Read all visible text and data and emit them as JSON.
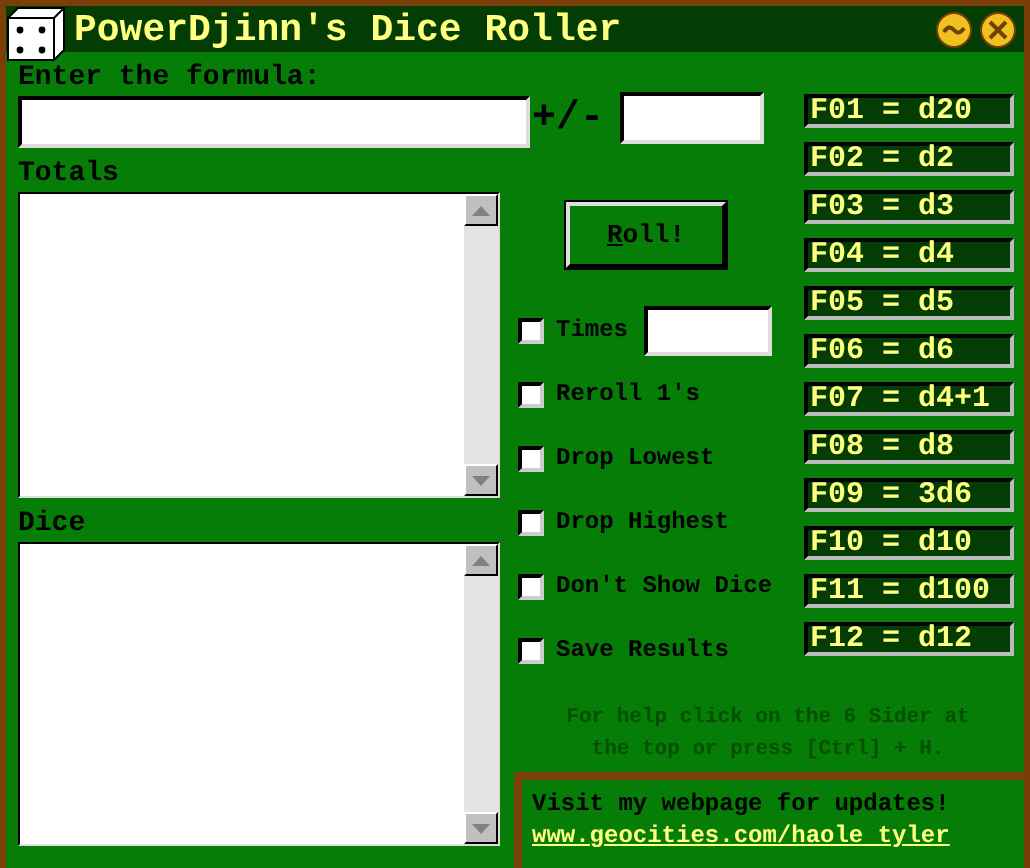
{
  "window": {
    "title": "PowerDjinn's Dice Roller"
  },
  "formula": {
    "label": "Enter the formula:",
    "modifier_label": "+/-"
  },
  "totals": {
    "label": "Totals"
  },
  "dice": {
    "label": "Dice"
  },
  "roll_button": {
    "underlined_part": "R",
    "rest": "oll!"
  },
  "options": [
    {
      "kind": "times",
      "label": "Times",
      "checked": false
    },
    {
      "kind": "plain",
      "label": "Reroll 1's",
      "checked": false
    },
    {
      "kind": "plain",
      "label": "Drop Lowest",
      "checked": false
    },
    {
      "kind": "plain",
      "label": "Drop Highest",
      "checked": false
    },
    {
      "kind": "plain",
      "label": "Don't Show Dice",
      "checked": false
    },
    {
      "kind": "plain",
      "label": "Save Results",
      "checked": false
    }
  ],
  "function_keys": [
    "F01 = d20",
    "F02 = d2",
    "F03 = d3",
    "F04 = d4",
    "F05 = d5",
    "F06 = d6",
    "F07 = d4+1",
    "F08 = d8",
    "F09 = 3d6",
    "F10 = d10",
    "F11 = d100",
    "F12 = d12"
  ],
  "help_text": "For help click on the 6 Sider at the top or press [Ctrl] + H.",
  "update_box": {
    "text": "Visit my webpage for updates!",
    "link": "www.geocities.com/haole tyler"
  }
}
